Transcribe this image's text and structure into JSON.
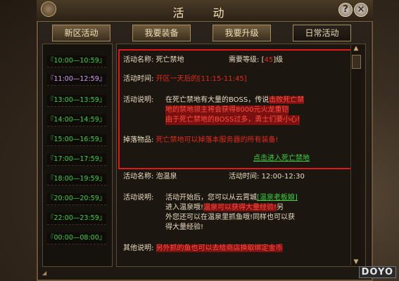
{
  "window": {
    "title": "活 动",
    "help_label": "?",
    "close_label": "×"
  },
  "tabs": [
    {
      "label": "新区活动",
      "active": false
    },
    {
      "label": "我要装备",
      "active": false
    },
    {
      "label": "我要升级",
      "active": false
    },
    {
      "label": "日常活动",
      "active": true
    }
  ],
  "time_slots": [
    {
      "label": "『10:00—10:59』",
      "color": "#3fd23f"
    },
    {
      "label": "『11:00—12:59』",
      "color": "#d0a0f0"
    },
    {
      "label": "『13:00—13:59』",
      "color": "#3fd23f"
    },
    {
      "label": "『14:00—14:59』",
      "color": "#3fd23f"
    },
    {
      "label": "『15:00—16:59』",
      "color": "#3fd23f"
    },
    {
      "label": "『17:00—17:59』",
      "color": "#3fd23f"
    },
    {
      "label": "『18:00—19:59』",
      "color": "#3fd23f"
    },
    {
      "label": "『20:00—20:59』",
      "color": "#3fd23f"
    },
    {
      "label": "『22:00—23:59』",
      "color": "#3fd23f"
    },
    {
      "label": "『00:00—08:00』",
      "color": "#3fd23f"
    }
  ],
  "event1": {
    "name_label": "活动名称:",
    "name": "死亡禁地",
    "level_label": "需要等级:",
    "level_open": "[",
    "level": "45",
    "level_close": "]级",
    "time_label": "活动时间:",
    "time": "开区一天后的[11:15-11:45]",
    "desc_label": "活动说明:",
    "desc_line1a": "在死亡禁地有大量的BOSS，传说",
    "desc_line1b": "击败死亡禁",
    "desc_line2": "地的禁地领主将会获得8000元火龙重铠",
    "desc_line3": "由于死亡禁地的BOSS过多，勇士们要小心!",
    "drop_label": "掉落物品:",
    "drop": "死亡禁地可以掉落本服务器的所有装备!",
    "link": "点击进入死亡禁地"
  },
  "event2": {
    "name_label": "活动名称:",
    "name": "泡温泉",
    "time_label": "活动时间:",
    "time": "12:00-12:30",
    "desc_label": "活动说明:",
    "desc_line1a": "活动开始后，您可以从云霄城",
    "desc_line1b": "[温泉老板娘]",
    "desc_line2a": "进入温泉哦!",
    "desc_line2b": "温泉可以获得大量经验!",
    "desc_line2c": "另",
    "desc_line3": "外您还可以在温泉里抓鱼哦!同样也可以获",
    "desc_line4": "得大量经验!",
    "other_label": "其他说明:",
    "other": "另外抓的鱼也可以去给商店换取绑定金币"
  },
  "watermark": "DOYO"
}
